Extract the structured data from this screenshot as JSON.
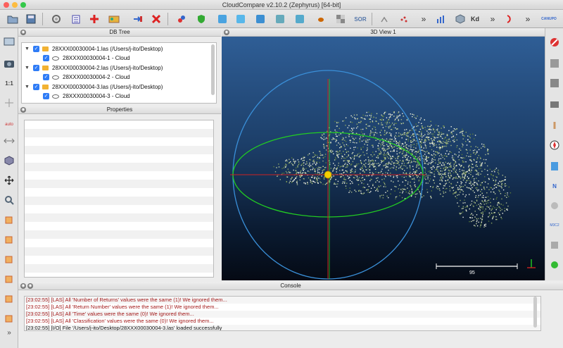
{
  "window": {
    "title": "CloudCompare v2.10.2 (Zephyrus) [64-bit]"
  },
  "toolbar": {
    "icons": [
      "open-icon",
      "save-icon",
      "settings-icon",
      "list-icon",
      "add-icon",
      "merge-icon",
      "clone-icon",
      "delete-icon",
      "sample-icon",
      "shield-icon",
      "cc-icon",
      "cc2-icon",
      "cc3-icon",
      "cc4-icon",
      "cc5-icon",
      "ant-icon",
      "checker-icon",
      "sor-icon",
      "tree-icon",
      "scatter-icon",
      "chart-icon",
      "kd-icon",
      "more-icon",
      "brush-icon",
      "more2-icon",
      "canupo-icon"
    ],
    "labels": {
      "sor": "SOR",
      "kd": "Kd",
      "more": "»",
      "canupo": "CANUPO"
    }
  },
  "dbtree": {
    "title": "DB Tree",
    "rows": [
      {
        "kind": "file",
        "label": "28XXX00030004-1.las (/Users/j-ito/Desktop)"
      },
      {
        "kind": "cloud",
        "label": "28XXX00030004-1 - Cloud"
      },
      {
        "kind": "file",
        "label": "28XXX00030004-2.las (/Users/j-ito/Desktop)"
      },
      {
        "kind": "cloud",
        "label": "28XXX00030004-2 - Cloud"
      },
      {
        "kind": "file",
        "label": "28XXX00030004-3.las (/Users/j-ito/Desktop)"
      },
      {
        "kind": "cloud",
        "label": "28XXX00030004-3 - Cloud"
      }
    ]
  },
  "properties": {
    "title": "Properties"
  },
  "view3d": {
    "title": "3D View 1",
    "scale_label": "95"
  },
  "left_tools": {
    "ratio_label": "1:1",
    "auto_label": "auto"
  },
  "console": {
    "title": "Console",
    "lines": [
      {
        "kind": "warn",
        "text": "[23:02:55] [LAS] All 'Number of Returns' values were the same (1)! We ignored them..."
      },
      {
        "kind": "warn",
        "text": "[23:02:55] [LAS] All 'Return Number' values were the same (1)! We ignored them..."
      },
      {
        "kind": "warn",
        "text": "[23:02:55] [LAS] All 'Time' values were the same (0)! We ignored them..."
      },
      {
        "kind": "warn",
        "text": "[23:02:55] [LAS] All 'Classification' values were the same (0)! We ignored them..."
      },
      {
        "kind": "ok",
        "text": "[23:02:55] [I/O] File '/Users/j-ito/Desktop/28XXX00030004-3.las' loaded successfully"
      }
    ]
  },
  "colors": {
    "view_top": "#2f5e96",
    "view_bottom": "#050a14",
    "warn": "#a31a1a",
    "axis_x": "#cc2222",
    "axis_y": "#22cc22",
    "sphere": "#3a8fd8",
    "pivot": "#f4d000"
  }
}
